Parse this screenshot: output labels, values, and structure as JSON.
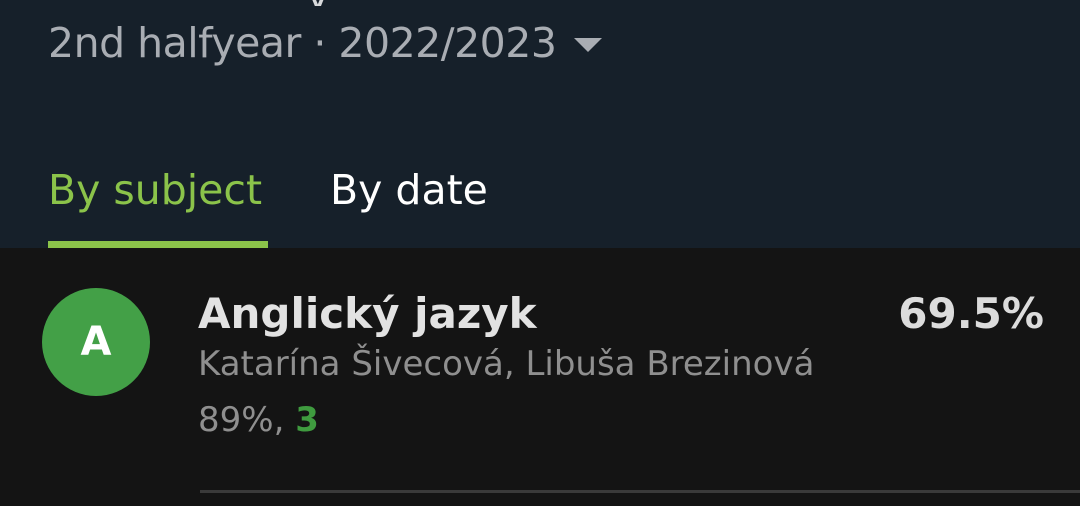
{
  "header": {
    "title_fragment": "y",
    "period_label": "2nd halfyear · 2022/2023",
    "period_dropdown_icon": "chevron-down-icon"
  },
  "tabs": [
    {
      "label": "By subject",
      "active": true
    },
    {
      "label": "By date",
      "active": false
    }
  ],
  "colors": {
    "accent": "#8bc34a",
    "header_bg": "#16202a",
    "list_bg": "#141414",
    "avatar_bg": "#43a047",
    "mark_color": "#3f9b3f"
  },
  "subjects": [
    {
      "initial": "A",
      "name": "Anglický jazyk",
      "teachers": "Katarína Šivecová, Libuša Brezinová",
      "percent": "89%",
      "separator": ",",
      "mark": "3",
      "average": "69.5%"
    }
  ]
}
